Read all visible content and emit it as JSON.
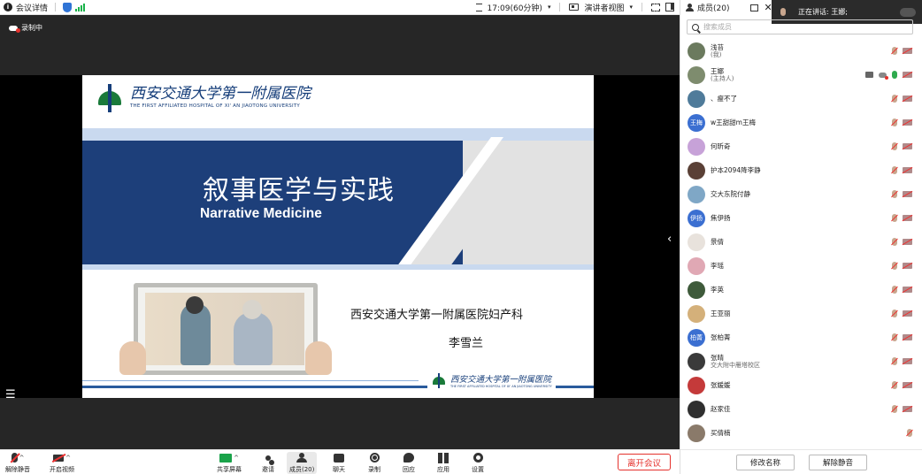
{
  "topbar": {
    "meeting_details": "会议详情",
    "timer": "17:09(60分钟)",
    "view_mode": "演讲者视图",
    "members_tab": "成员(20)"
  },
  "stage": {
    "recording_label": "录制中"
  },
  "slide": {
    "logo_cn": "西安交通大学第一附属医院",
    "logo_en": "THE FIRST AFFILIATED HOSPITAL OF XI' AN JIAOTONG UNIVERSITY",
    "title_cn": "叙事医学与实践",
    "title_en": "Narrative Medicine",
    "department": "西安交通大学第一附属医院妇产科",
    "author": "李雪兰",
    "footer_logo_cn": "西安交通大学第一附属医院",
    "footer_logo_en": "THE FIRST AFFILIATED HOSPITAL OF XI' AN JIAOTONG UNIVERSITY"
  },
  "toolbar": {
    "unmute": "解除静音",
    "start_video": "开启视频",
    "share_screen": "共享屏幕",
    "invite": "邀请",
    "members": "成员(20)",
    "chat": "聊天",
    "record": "录制",
    "reactions": "回应",
    "apps": "应用",
    "settings": "设置",
    "leave": "离开会议"
  },
  "panel": {
    "speaking_label": "正在讲话:",
    "speaking_name": "王娜;",
    "search_placeholder": "搜索成员",
    "members": [
      {
        "name": "浅苔",
        "sub": "(我)",
        "avatar": "img",
        "color": "#6b7a5e"
      },
      {
        "name": "王娜",
        "sub": "(主持人)",
        "avatar": "img",
        "color": "#7e8c6e",
        "host": true
      },
      {
        "name": "、瘦不了",
        "sub": "",
        "avatar": "img",
        "color": "#4f7b9a"
      },
      {
        "name": "w王甜甜m王梅",
        "sub": "",
        "avatar": "王梅",
        "color": "#3b6fd1"
      },
      {
        "name": "何昕奇",
        "sub": "",
        "avatar": "img",
        "color": "#c7a2d8"
      },
      {
        "name": "护本2094降李静",
        "sub": "",
        "avatar": "img",
        "color": "#5a4036"
      },
      {
        "name": "交大东院付静",
        "sub": "",
        "avatar": "img",
        "color": "#7fa7c6"
      },
      {
        "name": "焦伊扬",
        "sub": "",
        "avatar": "伊扬",
        "color": "#3b6fd1"
      },
      {
        "name": "景倩",
        "sub": "",
        "avatar": "img",
        "color": "#e8e2dc"
      },
      {
        "name": "李瑶",
        "sub": "",
        "avatar": "img",
        "color": "#e0a8b4"
      },
      {
        "name": "李英",
        "sub": "",
        "avatar": "img",
        "color": "#3e5a3a"
      },
      {
        "name": "王亚丽",
        "sub": "",
        "avatar": "img",
        "color": "#d4b07a"
      },
      {
        "name": "张柏菁",
        "sub": "",
        "avatar": "柏菁",
        "color": "#3b6fd1"
      },
      {
        "name": "张晴",
        "sub": "交大附中雁塔校区",
        "avatar": "img",
        "color": "#3a3a3a"
      },
      {
        "name": "张媛媛",
        "sub": "",
        "avatar": "img",
        "color": "#c43a3a"
      },
      {
        "name": "赵家佳",
        "sub": "",
        "avatar": "img",
        "color": "#2f2f2f"
      },
      {
        "name": "买倩楠",
        "sub": "",
        "avatar": "img",
        "color": "#8a7a6a"
      }
    ],
    "rename_button": "修改名称",
    "unmute_button": "解除静音"
  }
}
